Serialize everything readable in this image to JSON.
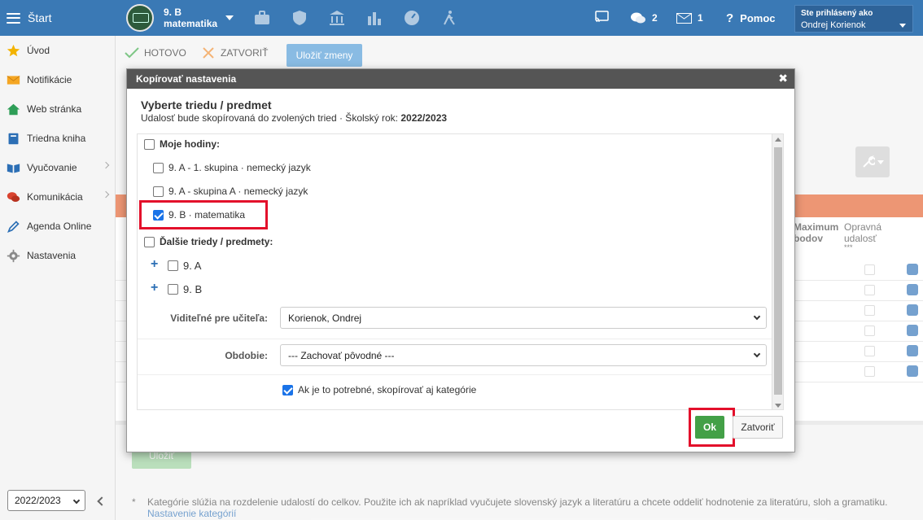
{
  "topbar": {
    "start_label": "Štart",
    "class_line1": "9. B",
    "class_line2": "matematika",
    "messages_count": "2",
    "mail_count": "1",
    "help_label": "Pomoc",
    "user_line1": "Ste prihlásený ako",
    "user_line2": "Ondrej Korienok"
  },
  "sidebar": {
    "items": [
      {
        "label": "Úvod",
        "icon": "star-icon"
      },
      {
        "label": "Notifikácie",
        "icon": "envelope-icon"
      },
      {
        "label": "Web stránka",
        "icon": "home-icon"
      },
      {
        "label": "Triedna kniha",
        "icon": "book-icon"
      },
      {
        "label": "Vyučovanie",
        "icon": "open-book-icon"
      },
      {
        "label": "Komunikácia",
        "icon": "chat-icon"
      },
      {
        "label": "Agenda Online",
        "icon": "pen-icon"
      },
      {
        "label": "Nastavenia",
        "icon": "gear-icon"
      }
    ],
    "year": "2022/2023"
  },
  "toolbar": {
    "done_label": "HOTOVO",
    "close_label": "ZATVORIŤ",
    "save_changes_label": "Uložiť zmeny"
  },
  "table": {
    "col_max_points": "Maximum bodov",
    "col_max_points_l1": "Maximum",
    "col_max_points_l2": "bodov",
    "col_retake_l1": "Opravná",
    "col_retake_l2": "udalosť",
    "col_retake_l3": "***",
    "rows": [
      "-",
      "-",
      "-",
      "-",
      "-",
      "-"
    ]
  },
  "save_button_label": "Uložiť",
  "footnote": {
    "star": "*",
    "text": "Kategórie slúžia na rozdelenie udalostí do celkov. Použite ich ak napríklad vyučujete slovenský jazyk a literatúru a chcete oddeliť hodnotenie za literatúru, sloh a gramatiku.",
    "link": "Nastavenie kategórií"
  },
  "modal": {
    "header": "Kopírovať nastavenia",
    "title": "Vyberte triedu / predmet",
    "subtitle_prefix": "Udalosť bude skopírovaná do zvolených tried · Školský rok:",
    "subtitle_year": "2022/2023",
    "my_hours_label": "Moje hodiny:",
    "my_hours": [
      {
        "label": "9. A - 1. skupina · nemecký jazyk",
        "checked": false
      },
      {
        "label": "9. A - skupina A · nemecký jazyk",
        "checked": false
      },
      {
        "label": "9. B · matematika",
        "checked": true
      }
    ],
    "other_label": "Ďalšie triedy / predmety:",
    "other_classes": [
      {
        "label": "9. A",
        "checked": false
      },
      {
        "label": "9. B",
        "checked": false
      }
    ],
    "visible_label": "Viditeľné pre učiteľa:",
    "visible_value": "Korienok, Ondrej",
    "period_label": "Obdobie:",
    "period_value": "--- Zachovať pôvodné ---",
    "copy_categories_label": "Ak je to potrebné, skopírovať aj kategórie",
    "copy_categories_checked": true,
    "ok_label": "Ok",
    "close_label": "Zatvoriť"
  },
  "colors": {
    "topbar": "#3a79b5",
    "accent_orange": "#e35e2a",
    "ok_green": "#43a047",
    "highlight_red": "#e3102b"
  }
}
